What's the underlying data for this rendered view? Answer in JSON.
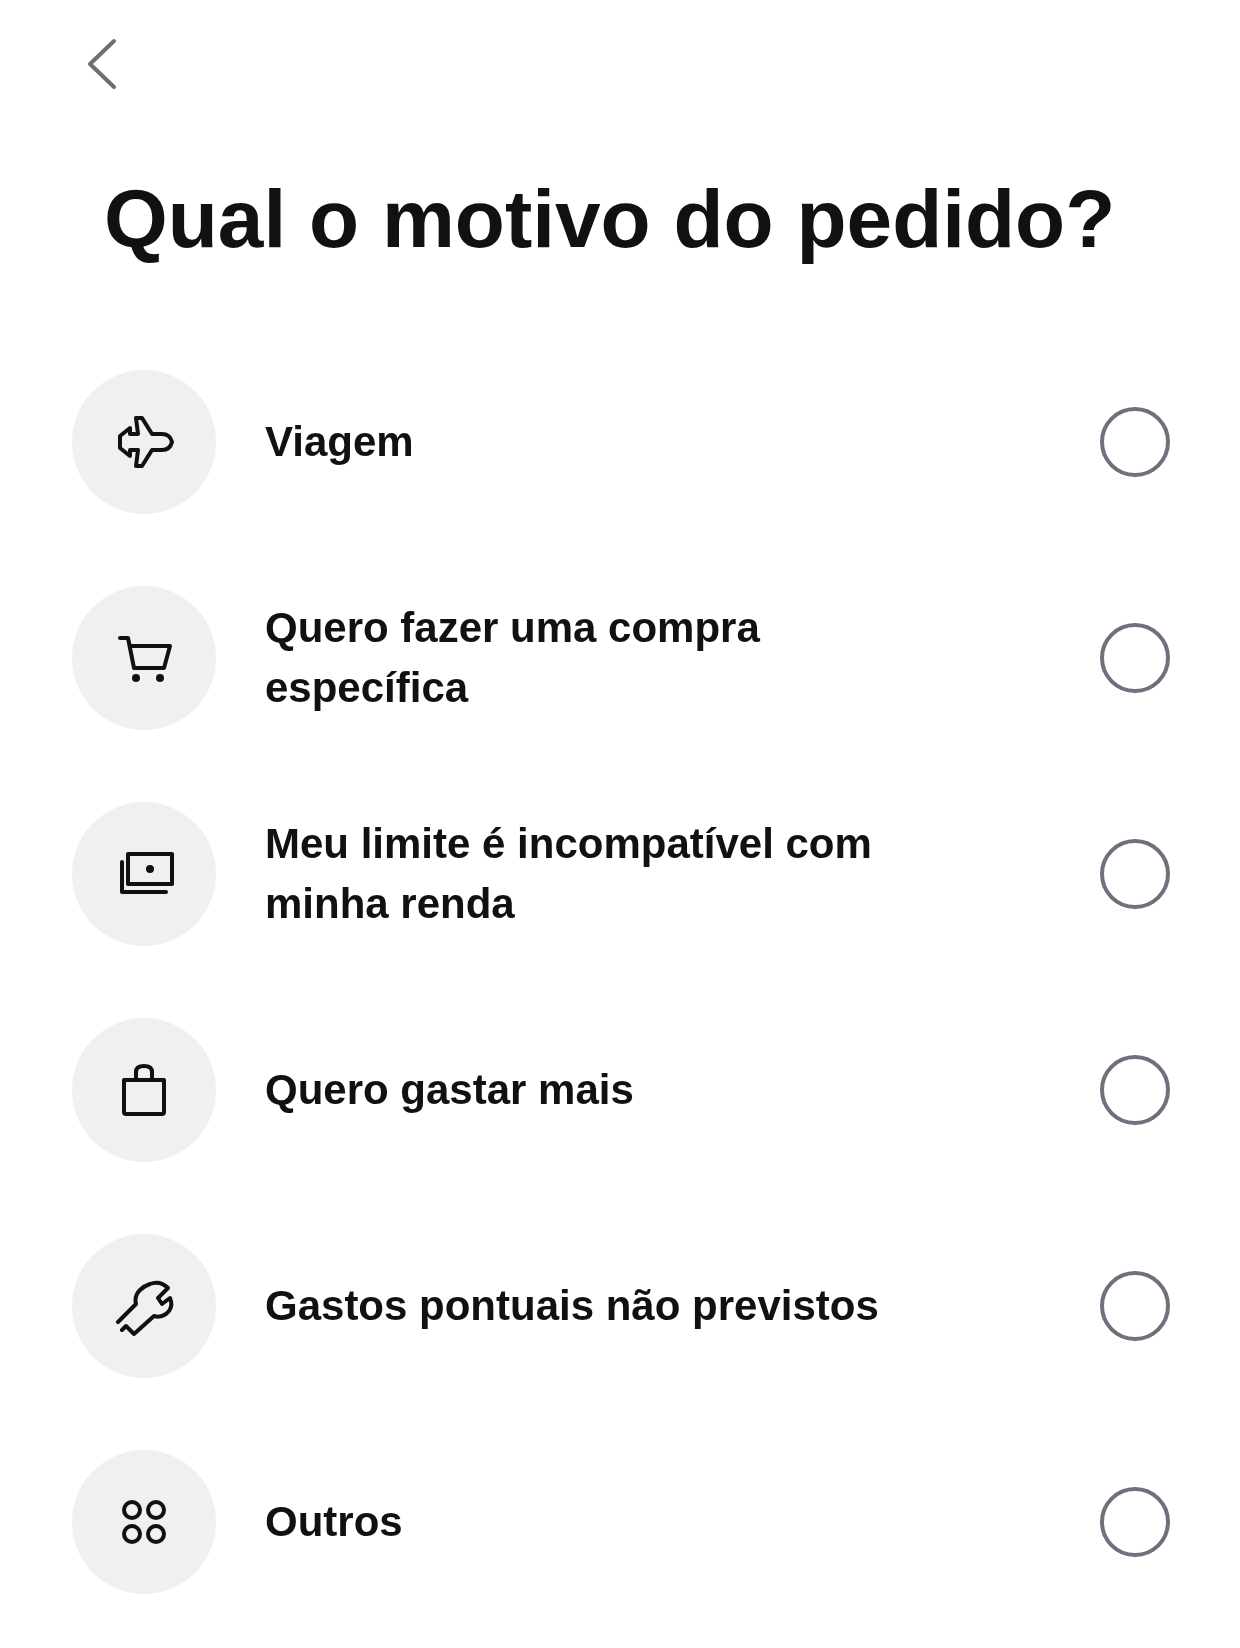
{
  "title": "Qual o motivo do pedido?",
  "options": [
    {
      "kind": "plane",
      "label": "Viagem",
      "selected": false
    },
    {
      "kind": "cart",
      "label": "Quero fazer uma compra específica",
      "selected": false
    },
    {
      "kind": "money",
      "label": "Meu limite é incompatível com minha renda",
      "selected": false
    },
    {
      "kind": "bag",
      "label": "Quero gastar mais",
      "selected": false
    },
    {
      "kind": "wrench",
      "label": "Gastos pontuais não previstos",
      "selected": false
    },
    {
      "kind": "grid",
      "label": "Outros",
      "selected": false
    }
  ]
}
